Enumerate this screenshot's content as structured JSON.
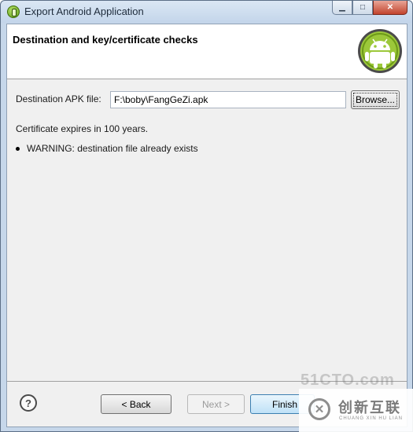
{
  "window": {
    "title": "Export Android Application",
    "controls": {
      "minimize": "▁",
      "maximize": "□",
      "close": "✕"
    }
  },
  "header": {
    "title": "Destination and key/certificate checks",
    "logo_icon": "android-logo-icon"
  },
  "form": {
    "destination_label": "Destination APK file:",
    "destination_value": "F:\\boby\\FangGeZi.apk",
    "browse_label": "Browse..."
  },
  "messages": {
    "certificate": "Certificate expires in 100 years.",
    "warning": "WARNING: destination file already exists"
  },
  "footer": {
    "help_icon": "?",
    "back_label": "< Back",
    "next_label": "Next >",
    "finish_label": "Finish"
  },
  "watermark": {
    "top_text": "51CTO.com",
    "cn_text": "创新互联",
    "en_text": "CHUANG XIN HU LIAN"
  },
  "colors": {
    "android_green": "#97c024",
    "titlebar": "#c3d5ea",
    "close_button": "#c2442d"
  }
}
